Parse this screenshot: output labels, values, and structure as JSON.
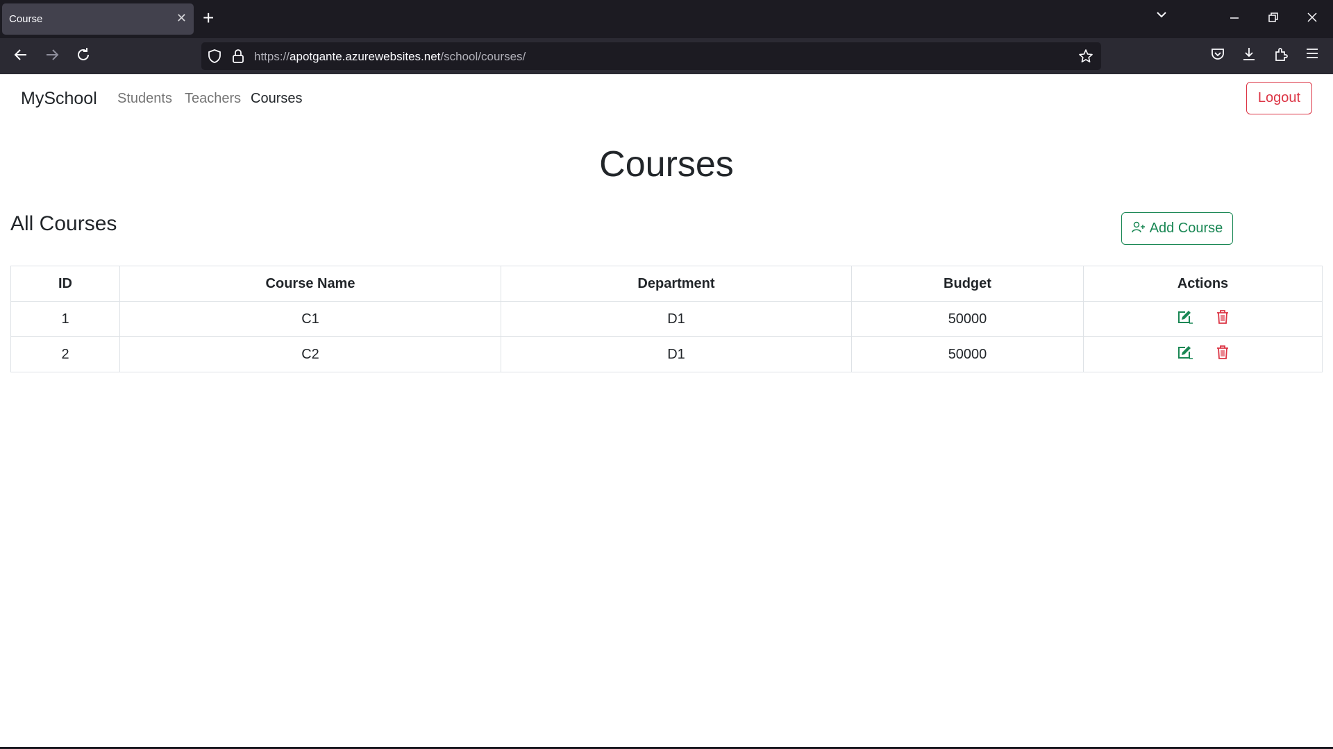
{
  "browser": {
    "tab_title": "Course",
    "url_host": "https://apotgante.azurewebsites.net",
    "url_path": "/school/courses/",
    "url_scheme": "https://",
    "url_domain": "apotgante.azurewebsites.net"
  },
  "navbar": {
    "brand": "MySchool",
    "links": [
      "Students",
      "Teachers",
      "Courses"
    ],
    "active": "Courses",
    "logout_label": "Logout"
  },
  "main": {
    "title": "Courses",
    "section_title": "All Courses",
    "add_button_label": "Add Course"
  },
  "table": {
    "headers": [
      "ID",
      "Course Name",
      "Department",
      "Budget",
      "Actions"
    ],
    "rows": [
      {
        "id": "1",
        "name": "C1",
        "department": "D1",
        "budget": "50000"
      },
      {
        "id": "2",
        "name": "C2",
        "department": "D1",
        "budget": "50000"
      }
    ]
  },
  "colors": {
    "success": "#198754",
    "danger": "#dc3545",
    "text": "#212529"
  },
  "icons": {
    "edit": "pencil-square-icon",
    "delete": "trash-icon",
    "add": "person-plus-icon"
  }
}
